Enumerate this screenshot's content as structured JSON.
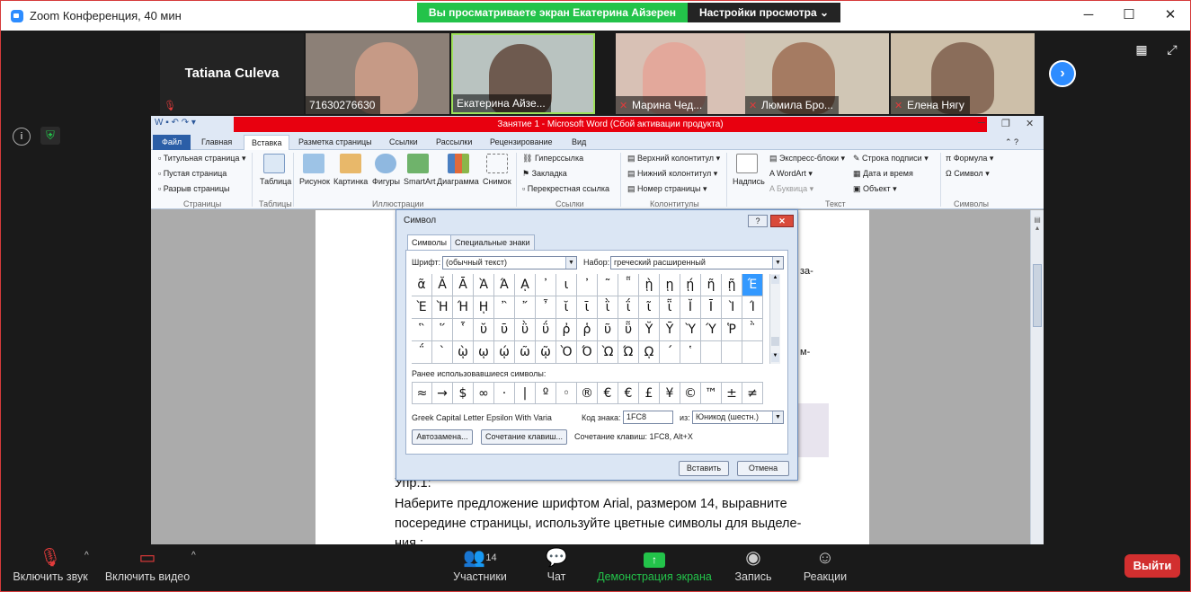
{
  "app": {
    "title": "Zoom Конференция, 40 мин",
    "share_banner": "Вы просматриваете экран Екатерина Айзерен",
    "view_options": "Настройки просмотра"
  },
  "participants": [
    {
      "name": "Tatiana Culeva",
      "muted": true
    },
    {
      "name": "71630276630",
      "muted": false
    },
    {
      "name": "Екатерина Айзе...",
      "muted": false
    },
    {
      "name": "Марина Чед...",
      "muted": true
    },
    {
      "name": "Люмила Бро...",
      "muted": true
    },
    {
      "name": "Елена Нягу",
      "muted": true
    }
  ],
  "word": {
    "title": "Занятие 1  -  Microsoft Word (Сбой активации продукта)",
    "tabs": [
      "Файл",
      "Главная",
      "Вставка",
      "Разметка страницы",
      "Ссылки",
      "Рассылки",
      "Рецензирование",
      "Вид"
    ],
    "ribbon": {
      "pages_items": [
        "Титульная страница",
        "Пустая страница",
        "Разрыв страницы"
      ],
      "table": "Таблица",
      "illustrations": [
        "Рисунок",
        "Картинка",
        "Фигуры",
        "SmartArt",
        "Диаграмма",
        "Снимок"
      ],
      "links": [
        "Гиперссылка",
        "Закладка",
        "Перекрестная ссылка"
      ],
      "header_footer": [
        "Верхний колонтитул",
        "Нижний колонтитул",
        "Номер страницы"
      ],
      "text_box": "Надпись",
      "text": [
        "Экспресс-блоки",
        "WordArt",
        "Буквица"
      ],
      "text2": [
        "Строка подписи",
        "Дата и время",
        "Объект"
      ],
      "symbols": [
        "Формула",
        "Символ"
      ],
      "groups": [
        "Страницы",
        "Таблицы",
        "Иллюстрации",
        "Ссылки",
        "Колонтитулы",
        "Текст",
        "Символы"
      ]
    },
    "doc_lines": [
      "Упр.1:",
      "Наберите предложение шрифтом Arial, размером 14, выравните",
      "посередине страницы, используйте цветные символы для выделе-",
      "ния :"
    ],
    "doc_fragments": [
      "за-",
      "м-"
    ]
  },
  "symbol_dialog": {
    "title": "Символ",
    "tabs": [
      "Символы",
      "Специальные знаки"
    ],
    "font_label": "Шрифт:",
    "font_value": "(обычный текст)",
    "subset_label": "Набор:",
    "subset_value": "греческий расширенный",
    "grid": [
      [
        "ᾶ",
        "Ᾰ",
        "Ᾱ",
        "Ὰ",
        "Ά",
        "ᾼ",
        "᾽",
        "ι",
        "᾿",
        "῀",
        "῁",
        "ῂ",
        "ῃ",
        "ῄ",
        "ῆ",
        "ῇ",
        "Έ"
      ],
      [
        "Ὲ",
        "Ὴ",
        "Ή",
        "ῌ",
        "῍",
        "῎",
        "῏",
        "ῐ",
        "ῑ",
        "ῒ",
        "ΐ",
        "ῖ",
        "ῗ",
        "Ῐ",
        "Ῑ",
        "Ὶ",
        "Ί"
      ],
      [
        "῝",
        "῞",
        "῟",
        "ῠ",
        "ῡ",
        "ῢ",
        "ΰ",
        "ῤ",
        "ῥ",
        "ῦ",
        "ῧ",
        "Ῠ",
        "Ῡ",
        "Ὺ",
        "Ύ",
        "Ῥ",
        "῭"
      ],
      [
        "΅",
        "`",
        "ῲ",
        "ῳ",
        "ῴ",
        "ῶ",
        "ῷ",
        "Ὸ",
        "Ό",
        "Ὼ",
        "Ώ",
        "ῼ",
        "´",
        "῾",
        "",
        "",
        ""
      ]
    ],
    "recent_label": "Ранее использовавшиеся символы:",
    "recent": [
      "≈",
      "→",
      "$",
      "∞",
      "·",
      "|",
      "º",
      "◦",
      "®",
      "€",
      "€",
      "£",
      "¥",
      "©",
      "™",
      "±",
      "≠"
    ],
    "char_name": "Greek Capital Letter Epsilon With Varia",
    "code_label": "Код знака:",
    "code_value": "1FC8",
    "from_label": "из:",
    "from_value": "Юникод (шестн.)",
    "autocorrect": "Автозамена...",
    "shortcut_key": "Сочетание клавиш...",
    "shortcut_text": "Сочетание клавиш: 1FC8, Alt+X",
    "insert": "Вставить",
    "cancel": "Отмена"
  },
  "toolbar": {
    "unmute": "Включить звук",
    "start_video": "Включить видео",
    "participants": "Участники",
    "participants_count": "14",
    "chat": "Чат",
    "share": "Демонстрация экрана",
    "record": "Запись",
    "reactions": "Реакции",
    "leave": "Выйти"
  },
  "colors": {
    "share_green": "#23c34a",
    "zoom_blue": "#2d8cff",
    "leave_red": "#d22f2f",
    "word_red": "#e8000f"
  }
}
